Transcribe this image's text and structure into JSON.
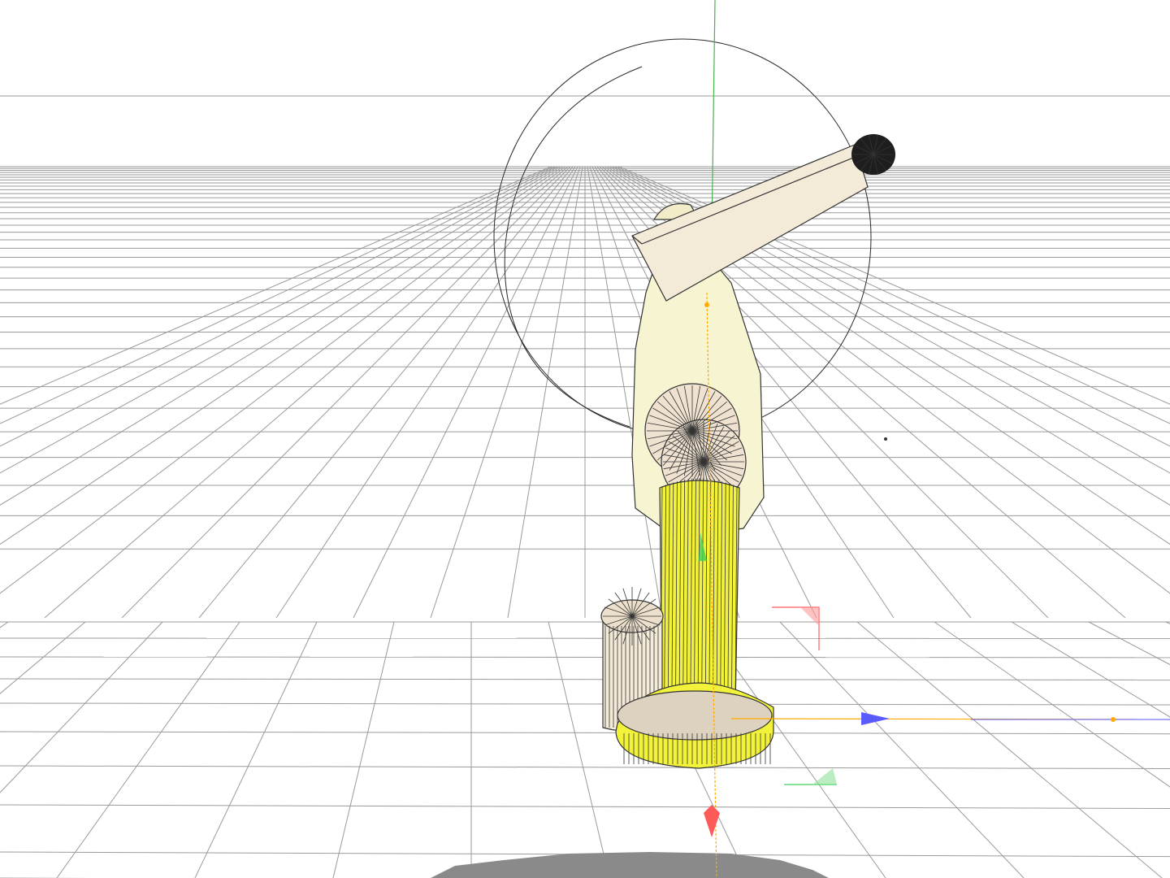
{
  "viewport": {
    "view": "perspective",
    "background_color": "#ffffff",
    "grid_color": "#9a9a9a",
    "model": "robot-arm",
    "selected_object": "robot-arm",
    "gizmo": {
      "x_axis_color": "#5a5aff",
      "y_axis_color": "#3fd15a",
      "z_axis_color": "#ff5a5a",
      "pivot_line_color": "#ffaa00",
      "guide_line_color": "#4caf50"
    },
    "materials": {
      "column_color": "#f2f23a",
      "arm_color": "#f7f4d2",
      "boom_color": "#f4ead8",
      "end_effector_color": "#1e1e1e",
      "shadow_color": "#8a8a8a"
    }
  }
}
